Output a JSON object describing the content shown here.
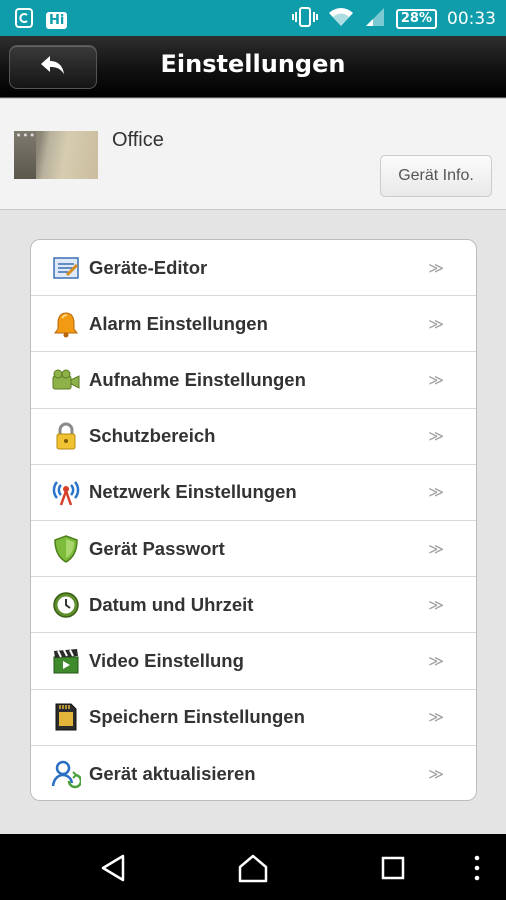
{
  "status_bar": {
    "time": "00:33",
    "battery": "28%",
    "hi_badge": "Hi",
    "icons": [
      "notification-icon",
      "hi-app-icon",
      "vibrate-icon",
      "wifi-icon",
      "signal-icon",
      "battery-icon"
    ],
    "background": "#0f9dab"
  },
  "titlebar": {
    "title": "Einstellungen",
    "back_icon": "back-arrow-icon"
  },
  "device": {
    "name": "Office",
    "info_button": "Gerät Info."
  },
  "settings": {
    "items": [
      {
        "label": "Geräte-Editor",
        "icon": "editor-icon",
        "chevron": "≫"
      },
      {
        "label": "Alarm Einstellungen",
        "icon": "bell-icon",
        "chevron": "≫"
      },
      {
        "label": "Aufnahme Einstellungen",
        "icon": "camcorder-icon",
        "chevron": "≫"
      },
      {
        "label": "Schutzbereich",
        "icon": "lock-icon",
        "chevron": "≫"
      },
      {
        "label": "Netzwerk Einstellungen",
        "icon": "antenna-icon",
        "chevron": "≫"
      },
      {
        "label": "Gerät Passwort",
        "icon": "shield-icon",
        "chevron": "≫"
      },
      {
        "label": "Datum und Uhrzeit",
        "icon": "clock-icon",
        "chevron": "≫"
      },
      {
        "label": "Video Einstellung",
        "icon": "clapperboard-icon",
        "chevron": "≫"
      },
      {
        "label": "Speichern Einstellungen",
        "icon": "sd-card-icon",
        "chevron": "≫"
      },
      {
        "label": "Gerät aktualisieren",
        "icon": "update-user-icon",
        "chevron": "≫"
      }
    ]
  },
  "navbar": {
    "icons": [
      "back-triangle-icon",
      "home-icon",
      "recents-icon",
      "overflow-menu-icon"
    ]
  }
}
